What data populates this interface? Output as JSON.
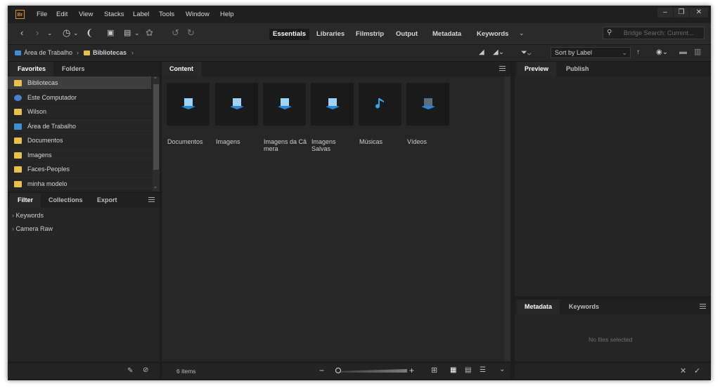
{
  "app": {
    "logo": "Br"
  },
  "menu": [
    "File",
    "Edit",
    "View",
    "Stacks",
    "Label",
    "Tools",
    "Window",
    "Help"
  ],
  "workspaces": [
    "Essentials",
    "Libraries",
    "Filmstrip",
    "Output",
    "Metadata",
    "Keywords"
  ],
  "active_workspace": "Essentials",
  "search": {
    "placeholder": "Bridge Search: Current..."
  },
  "path": {
    "root": "Área de Trabalho",
    "current": "Bibliotecas"
  },
  "sort": {
    "label": "Sort by Label"
  },
  "left_panel": {
    "tabs": [
      "Favorites",
      "Folders"
    ],
    "favorites": [
      {
        "label": "Bibliotecas",
        "icon": "libraries-folder-icon",
        "selected": true
      },
      {
        "label": "Este Computador",
        "icon": "computer-icon"
      },
      {
        "label": "Wilson",
        "icon": "user-folder-icon"
      },
      {
        "label": "Área de Trabalho",
        "icon": "desktop-icon"
      },
      {
        "label": "Documentos",
        "icon": "folder-icon"
      },
      {
        "label": "Imagens",
        "icon": "folder-icon"
      },
      {
        "label": "Faces-Peoples",
        "icon": "folder-icon"
      },
      {
        "label": "minha modelo",
        "icon": "folder-icon"
      }
    ],
    "filter_tabs": [
      "Filter",
      "Collections",
      "Export"
    ],
    "filters": [
      "Keywords",
      "Camera Raw"
    ]
  },
  "content": {
    "tab": "Content",
    "items": [
      {
        "label": "Documentos",
        "icon": "documents-library-icon"
      },
      {
        "label": "Imagens",
        "icon": "pictures-library-icon"
      },
      {
        "label": "Imagens da Câ mera",
        "icon": "camera-roll-library-icon"
      },
      {
        "label": "Imagens Salvas",
        "icon": "saved-pictures-library-icon"
      },
      {
        "label": "Músicas",
        "icon": "music-library-icon"
      },
      {
        "label": "Vídeos",
        "icon": "videos-library-icon"
      }
    ],
    "count": "6 items"
  },
  "right_panel": {
    "top_tabs": [
      "Preview",
      "Publish"
    ],
    "bottom_tabs": [
      "Metadata",
      "Keywords"
    ],
    "empty_message": "No files selected"
  },
  "colors": {
    "accent_folder": "#e8c14a",
    "accent_blue": "#3d8fd6",
    "app_logo": "#d7932d"
  }
}
